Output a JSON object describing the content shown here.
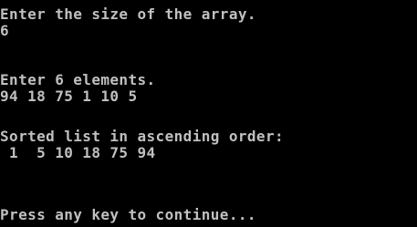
{
  "console": {
    "lines": {
      "prompt_size": "Enter the size of the array.",
      "input_size": "6",
      "prompt_elements": "Enter 6 elements.",
      "input_elements": "94 18 75 1 10 5",
      "sorted_heading": "Sorted list in ascending order:",
      "sorted_values": " 1  5 10 18 75 94",
      "press_key": "Press any key to continue..."
    },
    "colors": {
      "background": "#000000",
      "text": "#c0c0c0"
    }
  }
}
